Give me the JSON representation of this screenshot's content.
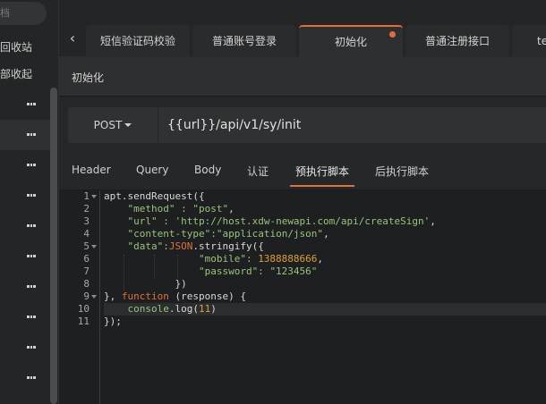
{
  "sidebar": {
    "search_placeholder": "档",
    "recycle_label": "回收站",
    "collapse_label": "部收起"
  },
  "tabs": {
    "back_icon": "chevron-left-icon",
    "items": [
      {
        "label": "短信验证码校验"
      },
      {
        "label": "普通账号登录"
      },
      {
        "label": "初始化",
        "modified": true
      },
      {
        "label": "普通注册接口"
      },
      {
        "label": "te"
      }
    ]
  },
  "title": "初始化",
  "request": {
    "method": "POST",
    "url": "{{url}}/api/v1/sy/init"
  },
  "sections": [
    "Header",
    "Query",
    "Body",
    "认证",
    "预执行脚本",
    "后执行脚本"
  ],
  "active_section": "预执行脚本",
  "accent_color": "#e0703a",
  "editor": {
    "line_numbers": [
      "1",
      "2",
      "3",
      "4",
      "5",
      "6",
      "7",
      "8",
      "9",
      "10",
      "11"
    ],
    "lines": {
      "l1": "apt.sendRequest({",
      "l2a": "    \"method\" : ",
      "l2b": "\"post\"",
      "l2c": ",",
      "l3a": "    \"url\" : ",
      "l3b": "'http://host.xdw-newapi.com/api/createSign'",
      "l3c": ",",
      "l4a": "    \"content-type\":",
      "l4b": "\"application/json\"",
      "l4c": ",",
      "l5a": "    \"data\":",
      "l5b": "JSON",
      "l5c": ".stringify({",
      "l6a": "                \"mobile\": ",
      "l6b": "1388888666",
      "l6c": ",",
      "l7a": "                \"password\": ",
      "l7b": "\"123456\"",
      "l8": "            })",
      "l9a": "}, ",
      "l9b": "function",
      "l9c": " (response) {",
      "l10a": "    ",
      "l10b": "console",
      "l10c": ".log(",
      "l10d": "11",
      "l10e": ")",
      "l11": "});"
    }
  }
}
